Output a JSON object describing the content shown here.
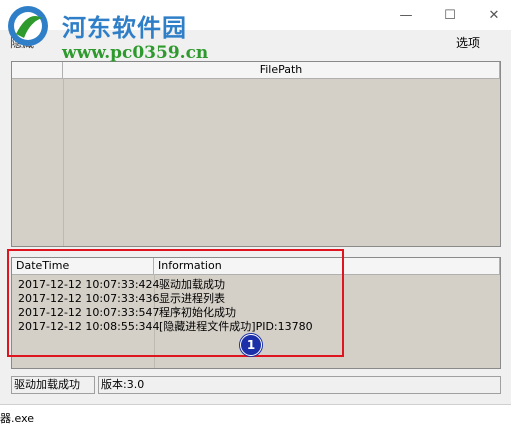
{
  "window": {
    "minimize": "—",
    "maximize": "☐",
    "close": "✕"
  },
  "watermark": {
    "title": "河东软件园",
    "url": "www.pc0359.cn"
  },
  "menu": {
    "left_label": "隐藏",
    "options_label": "选项"
  },
  "top_list": {
    "columns": [
      "",
      "FilePath"
    ]
  },
  "log_list": {
    "columns": [
      "DateTime",
      "Information"
    ],
    "rows": [
      {
        "datetime": "2017-12-12 10:07:33:424",
        "info": "驱动加载成功"
      },
      {
        "datetime": "2017-12-12 10:07:33:436",
        "info": "显示进程列表"
      },
      {
        "datetime": "2017-12-12 10:07:33:547",
        "info": "程序初始化成功"
      },
      {
        "datetime": "2017-12-12 10:08:55:344",
        "info": "[隐藏进程文件成功]PID:13780"
      }
    ]
  },
  "annotation": {
    "badge": "1",
    "color": "#e0141e"
  },
  "status": {
    "message": "驱动加载成功",
    "version": "版本:3.0"
  },
  "bottom": {
    "text": "器.exe"
  }
}
